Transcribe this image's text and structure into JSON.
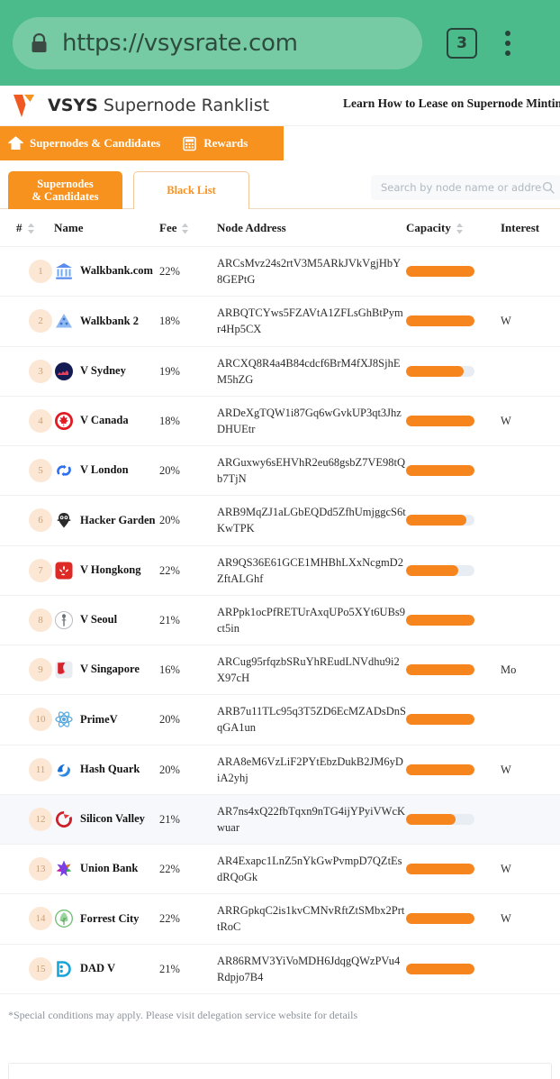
{
  "browser": {
    "url": "https://vsysrate.com",
    "lock_icon": "lock-icon",
    "tab_count": "3",
    "menu_icon": "kebab-menu-icon"
  },
  "header": {
    "brand_bold": "VSYS",
    "brand_light": "Supernode Ranklist",
    "promo_link": "Learn How to Lease on Supernode Minting",
    "nav": [
      {
        "label": "Supernodes & Candidates",
        "icon": "home-icon"
      },
      {
        "label": "Rewards",
        "icon": "calculator-icon"
      }
    ],
    "accent_color": "#f7921e",
    "chrome_color": "#4cbb8b"
  },
  "tabs": [
    {
      "label": "Supernodes\n& Candidates",
      "line1": "Supernodes",
      "line2": "& Candidates",
      "active": true
    },
    {
      "label": "Black List",
      "line1": "Black List",
      "line2": "",
      "active": false
    }
  ],
  "search": {
    "placeholder": "Search by node name or address",
    "value": "",
    "icon": "search-icon"
  },
  "table": {
    "columns": [
      {
        "key": "rank",
        "label": "#",
        "sortable": true
      },
      {
        "key": "name",
        "label": "Name",
        "sortable": false
      },
      {
        "key": "fee",
        "label": "Fee",
        "sortable": true
      },
      {
        "key": "address",
        "label": "Node Address",
        "sortable": false
      },
      {
        "key": "capacity",
        "label": "Capacity",
        "sortable": true
      },
      {
        "key": "interest",
        "label": "Interest",
        "sortable": false
      }
    ],
    "rows": [
      {
        "rank": "1",
        "name": "Walkbank.com",
        "fee": "22%",
        "address": "ARCsMvz24s2rtV3M5ARkJVkVgjHbY8GEPtG",
        "capacity_pct": 100,
        "interest": "",
        "icon": "bank-icon",
        "highlighted": false
      },
      {
        "rank": "2",
        "name": "Walkbank 2",
        "fee": "18%",
        "address": "ARBQTCYws5FZAVtA1ZFLsGhBtPymr4Hp5CX",
        "capacity_pct": 100,
        "interest": "W",
        "icon": "triangle-icon",
        "highlighted": false
      },
      {
        "rank": "3",
        "name": "V Sydney",
        "fee": "19%",
        "address": "ARCXQ8R4a4B84cdcf6BrM4fXJ8SjhEM5hZG",
        "capacity_pct": 84,
        "interest": "",
        "icon": "sydney-icon",
        "highlighted": false
      },
      {
        "rank": "4",
        "name": "V Canada",
        "fee": "18%",
        "address": "ARDeXgTQW1i87Gq6wGvkUP3qt3JhzDHUEtr",
        "capacity_pct": 100,
        "interest": "W",
        "icon": "canada-icon",
        "highlighted": false
      },
      {
        "rank": "5",
        "name": "V London",
        "fee": "20%",
        "address": "ARGuxwy6sEHVhR2eu68gsbZ7VE98tQb7TjN",
        "capacity_pct": 100,
        "interest": "",
        "icon": "london-icon",
        "highlighted": false
      },
      {
        "rank": "6",
        "name": "Hacker Garden",
        "fee": "20%",
        "address": "ARB9MqZJ1aLGbEQDd5ZfhUmjggcS6tKwTPK",
        "capacity_pct": 88,
        "interest": "",
        "icon": "owl-icon",
        "highlighted": false
      },
      {
        "rank": "7",
        "name": "V Hongkong",
        "fee": "22%",
        "address": "AR9QS36E61GCE1MHBhLXxNcgmD2ZftALGhf",
        "capacity_pct": 76,
        "interest": "",
        "icon": "hongkong-icon",
        "highlighted": false
      },
      {
        "rank": "8",
        "name": "V Seoul",
        "fee": "21%",
        "address": "ARPpk1ocPfRETUrAxqUPo5XYt6UBs9ct5in",
        "capacity_pct": 100,
        "interest": "",
        "icon": "seoul-icon",
        "highlighted": false
      },
      {
        "rank": "9",
        "name": "V Singapore",
        "fee": "16%",
        "address": "ARCug95rfqzbSRuYhREudLNVdhu9i2X97cH",
        "capacity_pct": 100,
        "interest": "Mo",
        "icon": "singapore-icon",
        "highlighted": false
      },
      {
        "rank": "10",
        "name": "PrimeV",
        "fee": "20%",
        "address": "ARB7u11TLc95q3T5ZD6EcMZADsDnSqGA1un",
        "capacity_pct": 100,
        "interest": "",
        "icon": "atom-icon",
        "highlighted": false
      },
      {
        "rank": "11",
        "name": "Hash Quark",
        "fee": "20%",
        "address": "ARA8eM6VzLiF2PYtEbzDukB2JM6yDiA2yhj",
        "capacity_pct": 100,
        "interest": "W",
        "icon": "hashquark-icon",
        "highlighted": false
      },
      {
        "rank": "12",
        "name": "Silicon Valley",
        "fee": "21%",
        "address": "AR7ns4xQ22fbTqxn9nTG4ijYPyiVWcKwuar",
        "capacity_pct": 72,
        "interest": "",
        "icon": "siliconvalley-icon",
        "highlighted": true
      },
      {
        "rank": "13",
        "name": "Union Bank",
        "fee": "22%",
        "address": "AR4Exapc1LnZ5nYkGwPvmpD7QZtEsdRQoGk",
        "capacity_pct": 100,
        "interest": "W",
        "icon": "unionbank-icon",
        "highlighted": false
      },
      {
        "rank": "14",
        "name": "Forrest City",
        "fee": "22%",
        "address": "ARRGpkqC2is1kvCMNvRftZtSMbx2PrttRoC",
        "capacity_pct": 100,
        "interest": "W",
        "icon": "forrestcity-icon",
        "highlighted": false
      },
      {
        "rank": "15",
        "name": "DAD V",
        "fee": "21%",
        "address": "AR86RMV3YiVoMDH6JdqgQWzPVu4Rdpjo7B4",
        "capacity_pct": 100,
        "interest": "",
        "icon": "dadv-icon",
        "highlighted": false
      }
    ]
  },
  "footnote": "*Special conditions may apply. Please visit delegation service website for details"
}
